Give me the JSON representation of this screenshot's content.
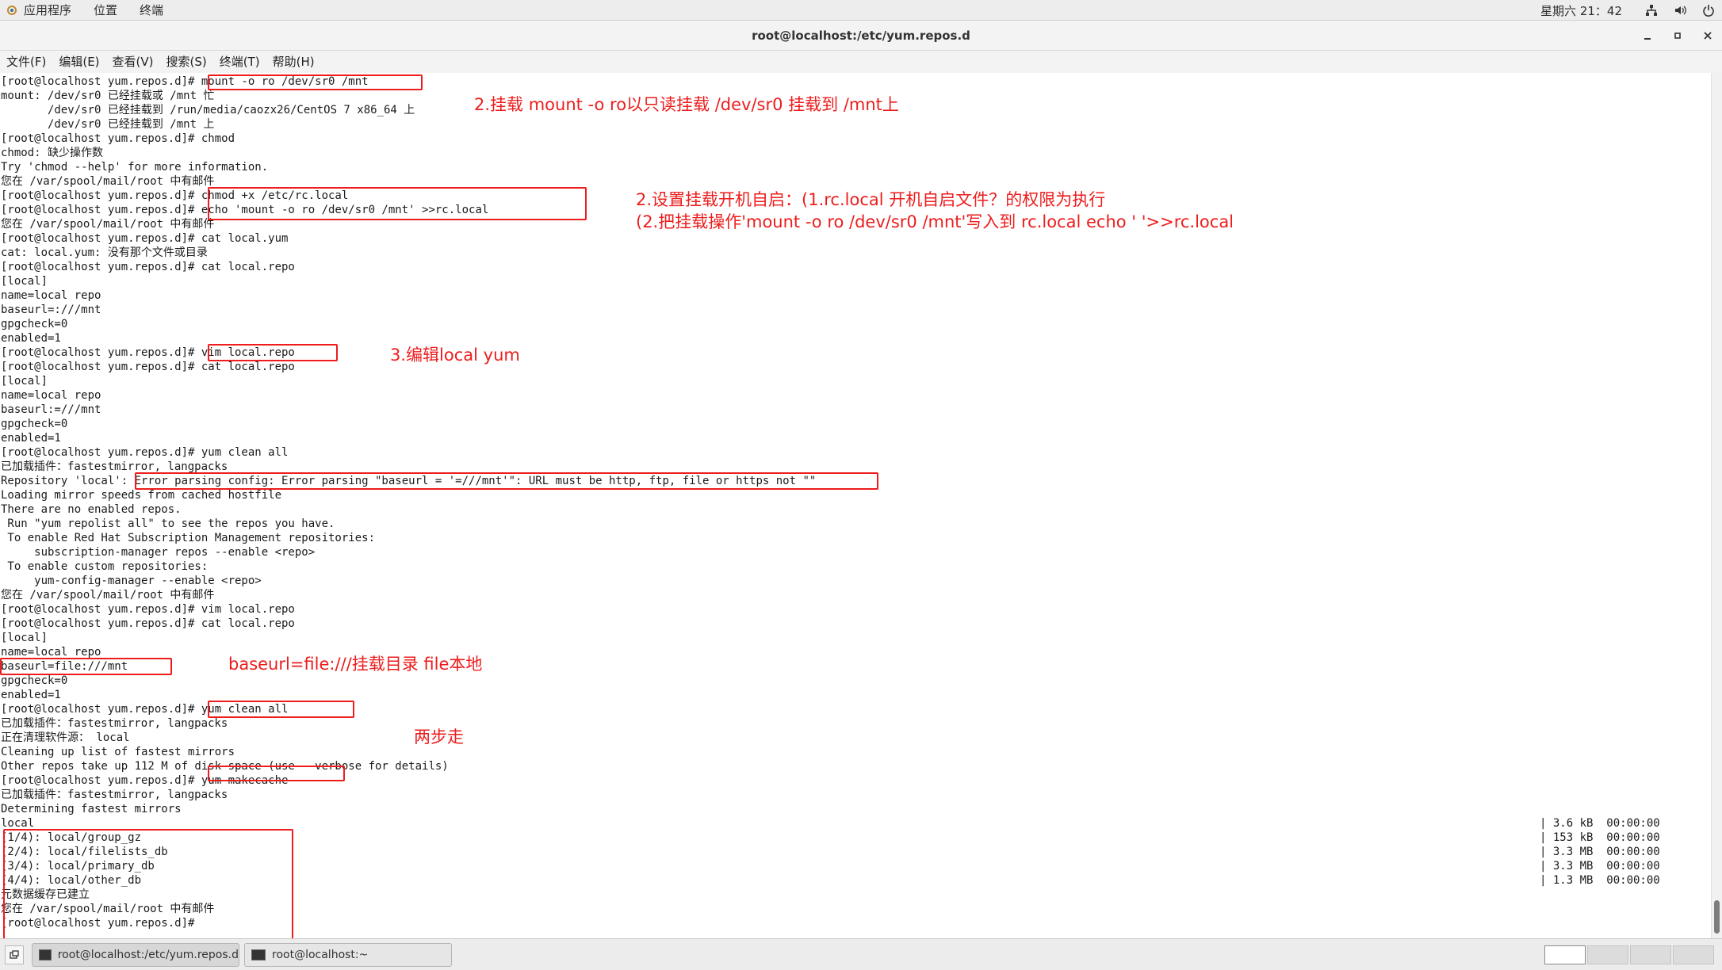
{
  "top_panel": {
    "apps": "应用程序",
    "places": "位置",
    "terminal": "终端",
    "clock": "星期六 21：42"
  },
  "window": {
    "title": "root@localhost:/etc/yum.repos.d"
  },
  "menubar": [
    "文件(F)",
    "编辑(E)",
    "查看(V)",
    "搜索(S)",
    "终端(T)",
    "帮助(H)"
  ],
  "terminal": {
    "lines": [
      "[root@localhost yum.repos.d]# mount -o ro /dev/sr0 /mnt",
      "mount: /dev/sr0 已经挂载或 /mnt 忙",
      "       /dev/sr0 已经挂载到 /run/media/caozx26/CentOS 7 x86_64 上",
      "       /dev/sr0 已经挂载到 /mnt 上",
      "[root@localhost yum.repos.d]# chmod",
      "chmod: 缺少操作数",
      "Try 'chmod --help' for more information.",
      "您在 /var/spool/mail/root 中有邮件",
      "[root@localhost yum.repos.d]# chmod +x /etc/rc.local",
      "[root@localhost yum.repos.d]# echo 'mount -o ro /dev/sr0 /mnt' >>rc.local",
      "您在 /var/spool/mail/root 中有邮件",
      "[root@localhost yum.repos.d]# cat local.yum",
      "cat: local.yum: 没有那个文件或目录",
      "[root@localhost yum.repos.d]# cat local.repo",
      "[local]",
      "name=local repo",
      "baseurl=:///mnt",
      "gpgcheck=0",
      "enabled=1",
      "[root@localhost yum.repos.d]# vim local.repo",
      "[root@localhost yum.repos.d]# cat local.repo",
      "[local]",
      "name=local repo",
      "baseurl:=///mnt",
      "gpgcheck=0",
      "enabled=1",
      "[root@localhost yum.repos.d]# yum clean all",
      "已加载插件：fastestmirror, langpacks",
      "Repository 'local': Error parsing config: Error parsing \"baseurl = '=///mnt'\": URL must be http, ftp, file or https not \"\"",
      "Loading mirror speeds from cached hostfile",
      "There are no enabled repos.",
      " Run \"yum repolist all\" to see the repos you have.",
      " To enable Red Hat Subscription Management repositories:",
      "     subscription-manager repos --enable <repo>",
      " To enable custom repositories:",
      "     yum-config-manager --enable <repo>",
      "您在 /var/spool/mail/root 中有邮件",
      "[root@localhost yum.repos.d]# vim local.repo",
      "[root@localhost yum.repos.d]# cat local.repo",
      "[local]",
      "name=local repo",
      "baseurl=file:///mnt",
      "gpgcheck=0",
      "enabled=1",
      "[root@localhost yum.repos.d]# yum clean all",
      "已加载插件：fastestmirror, langpacks",
      "正在清理软件源： local",
      "Cleaning up list of fastest mirrors",
      "Other repos take up 112 M of disk space (use --verbose for details)",
      "[root@localhost yum.repos.d]# yum makecache",
      "已加载插件：fastestmirror, langpacks",
      "Determining fastest mirrors",
      "local",
      "(1/4): local/group_gz",
      "(2/4): local/filelists_db",
      "(3/4): local/primary_db",
      "(4/4): local/other_db",
      "元数据缓存已建立",
      "您在 /var/spool/mail/root 中有邮件",
      "[root@localhost yum.repos.d]# "
    ],
    "right_column": [
      "| 3.6 kB  00:00:00",
      "| 153 kB  00:00:00",
      "| 3.3 MB  00:00:00",
      "| 3.3 MB  00:00:00",
      "| 1.3 MB  00:00:00"
    ]
  },
  "annotations": {
    "note1": "2.挂载  mount -o ro以只读挂载   /dev/sr0 挂载到 /mnt上",
    "note2a": "2.设置挂载开机自启：(1.rc.local 开机自启文件？的权限为执行",
    "note2b": "(2.把挂载操作'mount -o ro /dev/sr0 /mnt'写入到 rc.local echo ' '>>rc.local",
    "note3": "3.编辑local yum",
    "note4": "baseurl=file:///挂载目录 file本地",
    "note5": "两步走"
  },
  "taskbar": {
    "tasks": [
      "root@localhost:/etc/yum.repos.d",
      "root@localhost:~"
    ]
  },
  "colors": {
    "annotation": "#ee1c1c",
    "terminal_bg": "#ffffff",
    "terminal_fg": "#1a1a1a"
  }
}
